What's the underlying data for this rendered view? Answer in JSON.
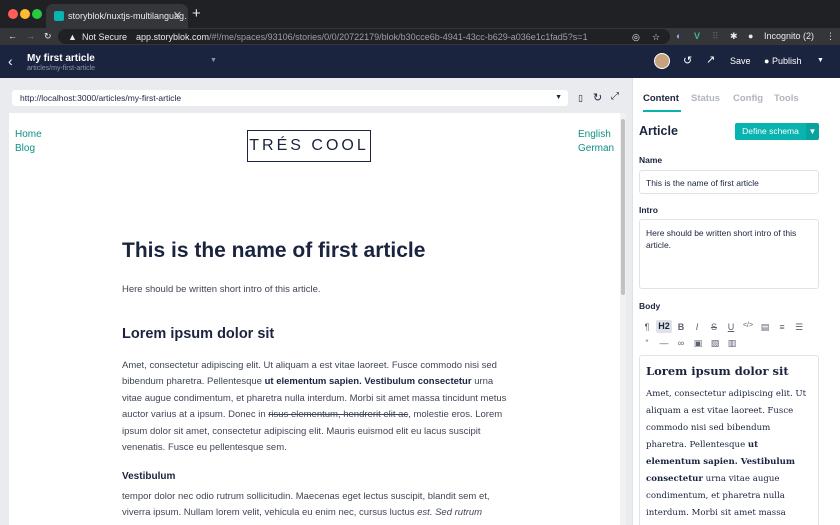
{
  "browser": {
    "tab_title": "storyblok/nuxtjs-multilanguag…",
    "security": "Not Secure",
    "url_host": "app.storyblok.com",
    "url_rest": "/#!/me/spaces/93106/stories/0/0/20722179/blok/b30cce6b-4941-43cc-b629-a036e1c1fad5?s=1",
    "profile": "Incognito (2)"
  },
  "header": {
    "title": "My first article",
    "slug": "articles/my-first-article",
    "save": "Save",
    "publish": "Publish"
  },
  "preview": {
    "address": "http://localhost:3000/articles/my-first-article",
    "nav_left": [
      "Home",
      "Blog"
    ],
    "nav_right": [
      "English",
      "German"
    ],
    "logo": "TRÉS COOL",
    "h1": "This is the name of first article",
    "intro": "Here should be written short intro of this article.",
    "h2": "Lorem ipsum dolor sit",
    "para": {
      "a": "Amet, consectetur adipiscing elit. Ut aliquam a est vitae laoreet. Fusce commodo nisi sed bibendum pharetra. Pellentesque ",
      "b": "ut elementum sapien. Vestibulum consectetur",
      "c": " urna vitae augue condimentum, et pharetra nulla interdum. Morbi sit amet massa tincidunt metus auctor varius at a ipsum. Donec in ",
      "s": "risus elementum, hendrerit elit ac",
      "d": ", molestie eros. Lorem ipsum dolor sit amet, consectetur adipiscing elit. Mauris euismod elit eu lacus suscipit venenatis. Fusce eu pellentesque sem."
    },
    "h3": "Vestibulum",
    "para2": "tempor dolor nec odio rutrum sollicitudin. Maecenas eget lectus suscipit, blandit sem et, viverra ipsum. Nullam lorem velit, vehicula eu enim nec, cursus luctus ",
    "para2_em": "est. Sed rutrum"
  },
  "sidebar": {
    "tabs": [
      "Content",
      "Status",
      "Config",
      "Tools"
    ],
    "component": "Article",
    "define_schema": "Define schema",
    "name_label": "Name",
    "name_value": "This is the name of first article",
    "intro_label": "Intro",
    "intro_value": "Here should be written short intro of this article.",
    "body_label": "Body",
    "toolbar": [
      "¶",
      "H2",
      "B",
      "I",
      "S",
      "U",
      "</>",
      "▤",
      "≡",
      "☰",
      "“",
      "—",
      "∞",
      "▣",
      "▧",
      "▥"
    ],
    "editor_heading": "Lorem ipsum dolor sit",
    "editor_a": "Amet, consectetur adipiscing elit. Ut aliquam a est vitae laoreet. Fusce commodo nisi sed bibendum pharetra. Pellentesque ",
    "editor_b": "ut elementum sapien. Vestibulum consectetur",
    "editor_c": " urna vitae augue condimentum, et pharetra nulla interdum. Morbi sit amet massa tincidunt metus auctor varius at a"
  },
  "colors": {
    "accent": "#09b3af",
    "header": "#1b243f"
  }
}
